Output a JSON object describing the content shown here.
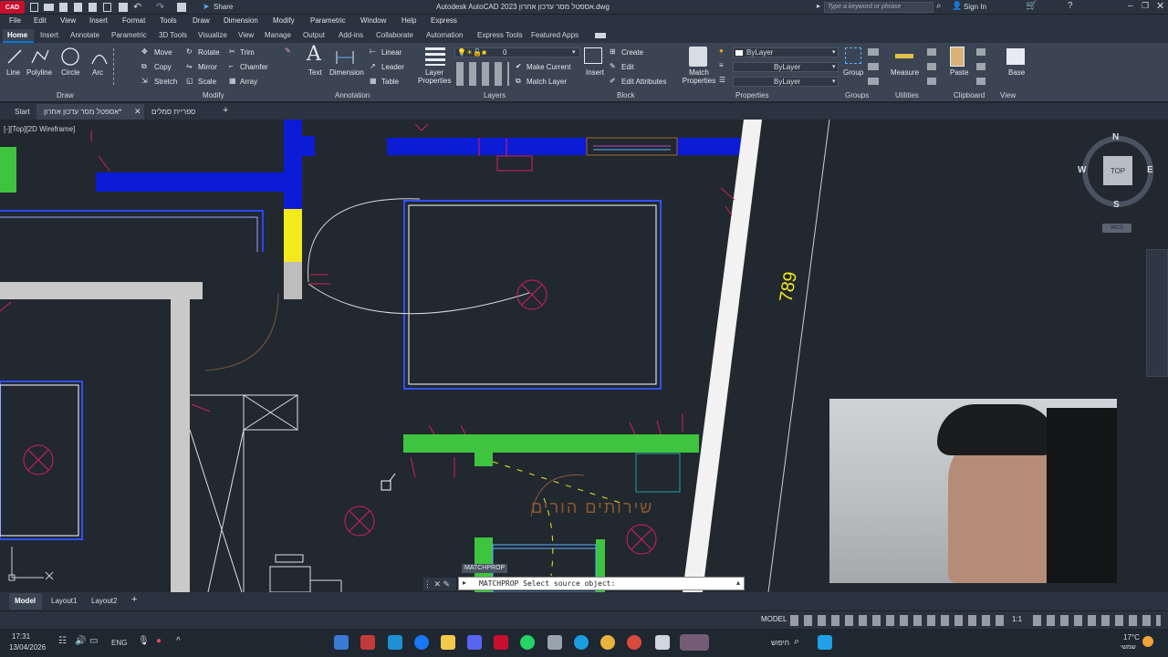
{
  "titlebar": {
    "app_badge": "CAD",
    "title": "Autodesk AutoCAD 2023  אספטל מסר עדכון אחרון.dwg",
    "share": "Share",
    "search_placeholder": "Type a keyword or phrase",
    "sign_in": "Sign In"
  },
  "menu": [
    "File",
    "Edit",
    "View",
    "Insert",
    "Format",
    "Tools",
    "Draw",
    "Dimension",
    "Modify",
    "Parametric",
    "Window",
    "Help",
    "Express"
  ],
  "ribbon_tabs": [
    "Home",
    "Insert",
    "Annotate",
    "Parametric",
    "3D Tools",
    "Visualize",
    "View",
    "Manage",
    "Output",
    "Add-ins",
    "Collaborate",
    "Automation",
    "Express Tools",
    "Featured Apps"
  ],
  "ribbon": {
    "draw": {
      "line": "Line",
      "polyline": "Polyline",
      "circle": "Circle",
      "arc": "Arc",
      "label": "Draw"
    },
    "modify": {
      "move": "Move",
      "rotate": "Rotate",
      "trim": "Trim",
      "copy": "Copy",
      "mirror": "Mirror",
      "chamfer": "Chamfer",
      "stretch": "Stretch",
      "scale": "Scale",
      "array": "Array",
      "label": "Modify"
    },
    "annotation": {
      "text": "Text",
      "dimension": "Dimension",
      "linear": "Linear",
      "leader": "Leader",
      "table": "Table",
      "label": "Annotation"
    },
    "layers": {
      "properties": "Layer Properties",
      "current": "0",
      "make_current": "Make Current",
      "match_layer": "Match Layer",
      "label": "Layers"
    },
    "block": {
      "insert": "Insert",
      "create": "Create",
      "edit": "Edit",
      "edit_attributes": "Edit Attributes",
      "label": "Block"
    },
    "properties": {
      "match": "Match Properties",
      "bylayer1": "ByLayer",
      "bylayer2": "ByLayer",
      "bylayer3": "ByLayer",
      "label": "Properties"
    },
    "groups": {
      "group": "Group",
      "label": "Groups"
    },
    "utilities": {
      "measure": "Measure",
      "label": "Utilities"
    },
    "clipboard": {
      "paste": "Paste",
      "label": "Clipboard"
    },
    "view": {
      "base": "Base",
      "label": "View"
    }
  },
  "file_tabs": {
    "start": "Start",
    "active": "אספטל מסר עדכון אחרון*",
    "other": "ספריית סמלים"
  },
  "viewport": {
    "label": "[-][Top][2D Wireframe]",
    "dimension_text": "789",
    "room_label": "שירותים הורים",
    "viewcube": {
      "n": "N",
      "s": "S",
      "e": "E",
      "w": "W",
      "top": "TOP",
      "wcs": "WCS"
    },
    "tooltip": "MATCHPROP",
    "command": "MATCHPROP Select source object:"
  },
  "layout_tabs": [
    "Model",
    "Layout1",
    "Layout2"
  ],
  "status": {
    "model": "MODEL",
    "scale": "1:1"
  },
  "taskbar": {
    "time": "17:31",
    "date": "13/04/2026",
    "lang": "ENG",
    "search": "חיפוש",
    "weather_temp": "17°C",
    "weather_label": "שמשי"
  },
  "colors": {
    "accent": "#0078d7",
    "wall_blue": "#0b1bd6",
    "wall_green": "#3ec43e",
    "yellow": "#f2ea1d",
    "fixture": "#d61f5a"
  }
}
